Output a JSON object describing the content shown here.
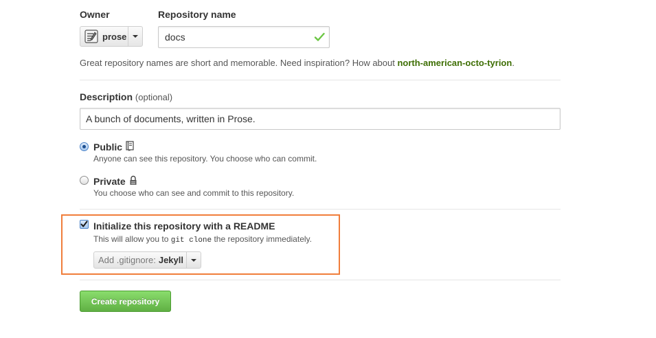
{
  "owner": {
    "label": "Owner",
    "selected": "prose",
    "avatar_icon": "prose-logo-icon"
  },
  "repository": {
    "label": "Repository name",
    "value": "docs",
    "valid": true,
    "valid_color": "#6cc644"
  },
  "hint": {
    "text": "Great repository names are short and memorable. Need inspiration? How about ",
    "suggestion": "north-american-octo-tyrion",
    "suffix": "."
  },
  "description": {
    "label": "Description",
    "optional_note": "(optional)",
    "value": "A bunch of documents, written in Prose."
  },
  "visibility": {
    "selected": "public",
    "options": [
      {
        "key": "public",
        "label": "Public",
        "icon": "repo-book-icon",
        "description": "Anyone can see this repository. You choose who can commit."
      },
      {
        "key": "private",
        "label": "Private",
        "icon": "lock-icon",
        "description": "You choose who can see and commit to this repository."
      }
    ]
  },
  "init_readme": {
    "checked": true,
    "label": "Initialize this repository with a README",
    "desc_before": "This will allow you to ",
    "code": "git clone",
    "desc_after": " the repository immediately.",
    "highlight_color": "#f07d3a"
  },
  "gitignore": {
    "prefix": "Add .gitignore:",
    "value": "Jekyll"
  },
  "submit": {
    "label": "Create repository",
    "color": "#60b044"
  }
}
